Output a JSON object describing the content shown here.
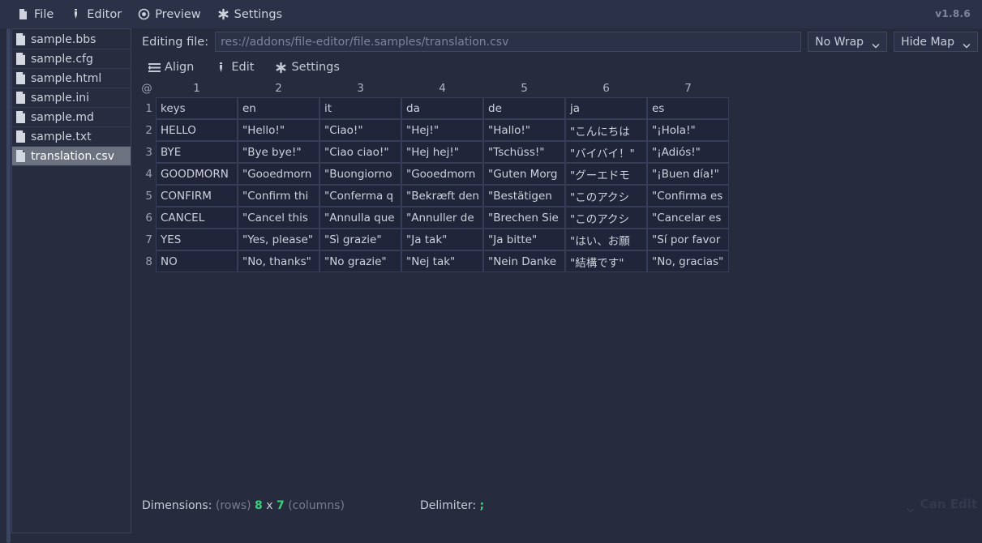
{
  "app": {
    "version": "v1.8.6",
    "menu": [
      {
        "label": "File",
        "icon": "document-icon"
      },
      {
        "label": "Editor",
        "icon": "pencil-icon"
      },
      {
        "label": "Preview",
        "icon": "target-icon"
      },
      {
        "label": "Settings",
        "icon": "gear-icon"
      }
    ]
  },
  "sidebar": {
    "files": [
      {
        "name": "sample.bbs",
        "selected": false
      },
      {
        "name": "sample.cfg",
        "selected": false
      },
      {
        "name": "sample.html",
        "selected": false
      },
      {
        "name": "sample.ini",
        "selected": false
      },
      {
        "name": "sample.md",
        "selected": false
      },
      {
        "name": "sample.txt",
        "selected": false
      },
      {
        "name": "translation.csv",
        "selected": true
      }
    ]
  },
  "editbar": {
    "label": "Editing file:",
    "path_value": "res://addons/file-editor/file.samples/translation.csv",
    "wrap_mode": "No Wrap",
    "map_mode": "Hide Map"
  },
  "toolbar": {
    "items": [
      {
        "label": "Align",
        "icon": "align-list-icon"
      },
      {
        "label": "Edit",
        "icon": "pencil-icon"
      },
      {
        "label": "Settings",
        "icon": "gear-icon"
      }
    ]
  },
  "grid": {
    "corner_label": "@",
    "column_numbers": [
      "1",
      "2",
      "3",
      "4",
      "5",
      "6",
      "7"
    ],
    "row_numbers": [
      "1",
      "2",
      "3",
      "4",
      "5",
      "6",
      "7",
      "8"
    ],
    "rows": [
      [
        "keys",
        "en",
        "it",
        "da",
        "de",
        "ja",
        "es"
      ],
      [
        "HELLO",
        "\"Hello!\"",
        "\"Ciao!\"",
        "\"Hej!\"",
        "\"Hallo!\"",
        "\"こんにちは",
        "\"¡Hola!\""
      ],
      [
        "BYE",
        "\"Bye bye!\"",
        "\"Ciao ciao!\"",
        "\"Hej hej!\"",
        "\"Tschüss!\"",
        "\"バイバイ！\"",
        "\"¡Adiós!\""
      ],
      [
        "GOODMORN",
        "\"Gooedmorn",
        "\"Buongiorno",
        "\"Gooedmorn",
        "\"Guten Morg",
        "\"グーエドモ",
        "\"¡Buen día!\""
      ],
      [
        "CONFIRM",
        "\"Confirm thi",
        "\"Conferma q",
        "\"Bekræft den",
        "\"Bestätigen",
        "\"このアクシ",
        "\"Confirma es"
      ],
      [
        "CANCEL",
        "\"Cancel this",
        "\"Annulla que",
        "\"Annuller de",
        "\"Brechen Sie",
        "\"このアクシ",
        "\"Cancelar es"
      ],
      [
        "YES",
        "\"Yes, please\"",
        "\"Sì grazie\"",
        "\"Ja tak\"",
        "\"Ja bitte\"",
        "\"はい、お願",
        "\"Sí por favor"
      ],
      [
        "NO",
        "\"No, thanks\"",
        "\"No grazie\"",
        "\"Nej tak\"",
        "\"Nein Danke",
        "\"結構です\"",
        "\"No, gracias\""
      ]
    ]
  },
  "footer": {
    "dimensions_label": "Dimensions:",
    "rows_word": "(rows)",
    "rows_count": "8",
    "times": "x",
    "columns_count": "7",
    "columns_word": "(columns)",
    "delimiter_label": "Delimiter:",
    "delimiter_value": ";",
    "can_edit_label": "Can Edit"
  },
  "colors": {
    "background": "#262c3d",
    "menubar": "#2b3247",
    "cell": "#21253a",
    "accent_green": "#3ad07a",
    "selected": "#6d7280"
  }
}
